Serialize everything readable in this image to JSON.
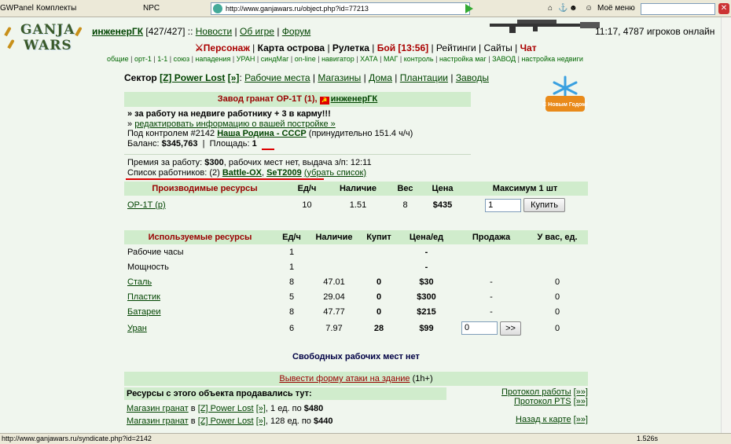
{
  "browser": {
    "toolbar_items": [
      "GWPanel",
      "Комплекты",
      "NPC"
    ],
    "url": "http://www.ganjawars.ru/object.php?id=77213",
    "menu_label": "Моё меню",
    "status_url": "http://www.ganjawars.ru/syndicate.php?id=2142",
    "load_time": "1.526s"
  },
  "logo": {
    "line1": "GANJA",
    "line2": "WARS"
  },
  "header": {
    "username": "инженерГК",
    "hp": "[427/427]",
    "links": [
      "Новости",
      "Об игре",
      "Форум"
    ],
    "clock": "11:17, 4787 игроков онлайн"
  },
  "nav": {
    "items": [
      "Персонаж",
      "Карта острова",
      "Рулетка",
      "Бой [13:56]",
      "Рейтинги",
      "Сайты",
      "Чат"
    ],
    "sub": [
      "общие",
      "орт-1",
      "1-1",
      "союз",
      "нападения",
      "УРАН",
      "синдМаг",
      "on-line",
      "навигатор",
      "ХАТА",
      "МАГ",
      "контроль",
      "настройка маг",
      "ЗАВОД",
      "настройка недвиги"
    ]
  },
  "sector": {
    "label": "Сектор",
    "name": "[Z] Power Lost",
    "arrow": "[»]",
    "links": [
      "Рабочие места",
      "Магазины",
      "Дома",
      "Плантации",
      "Заводы"
    ]
  },
  "snowflake_text": "С Новым Годом!",
  "factory": {
    "name": "Завод гранат OP-1T",
    "level": "(1),",
    "owner": "инженерГК",
    "karma_line": "» за работу на недвиге работнику + 3 в карму!!!",
    "edit_link": "редактировать информацию о вашей постройке »",
    "control_prefix": "Под контролем #2142",
    "control_name": "Наша Родина - СССР",
    "control_suffix": "(принудительно 151.4 ч/ч)",
    "balance_label": "Баланс:",
    "balance": "$345,763",
    "area_label": "Площадь:",
    "area": "1",
    "premium_label": "Премия за работу:",
    "premium": "$300",
    "premium_rest": ", рабочих мест нет, выдача з/п: 12:11",
    "workers_label": "Список работников: (2)",
    "workers": [
      "Battle-OX",
      "SeT2009"
    ],
    "remove_list": "(убрать список)"
  },
  "produced": {
    "headers": [
      "Производимые ресурсы",
      "Ед/ч",
      "Наличие",
      "Вес",
      "Цена",
      "Максимум 1 шт"
    ],
    "row": {
      "name": "OP-1T (р)",
      "rate": "10",
      "stock": "1.51",
      "weight": "8",
      "price": "$435",
      "qty": "1",
      "buy": "Купить"
    }
  },
  "used": {
    "headers": [
      "Используемые ресурсы",
      "Ед/ч",
      "Наличие",
      "Купит",
      "Цена/ед",
      "Продажа",
      "У вас, ед."
    ],
    "rows": [
      {
        "name": "Рабочие часы",
        "rate": "1",
        "stock": "",
        "buys": "",
        "price": "-",
        "sale": "",
        "have": "",
        "link": false
      },
      {
        "name": "Мощность",
        "rate": "1",
        "stock": "",
        "buys": "",
        "price": "-",
        "sale": "",
        "have": "",
        "link": false
      },
      {
        "name": "Сталь",
        "rate": "8",
        "stock": "47.01",
        "buys": "0",
        "price": "$30",
        "sale": "-",
        "have": "0",
        "link": true
      },
      {
        "name": "Пластик",
        "rate": "5",
        "stock": "29.04",
        "buys": "0",
        "price": "$300",
        "sale": "-",
        "have": "0",
        "link": true
      },
      {
        "name": "Батареи",
        "rate": "8",
        "stock": "47.77",
        "buys": "0",
        "price": "$215",
        "sale": "-",
        "have": "0",
        "link": true
      },
      {
        "name": "Уран",
        "rate": "6",
        "stock": "7.97",
        "buys": "28",
        "price": "$99",
        "sale": "input",
        "have": "0",
        "link": true
      }
    ],
    "sale_input": "0",
    "sale_button": ">>"
  },
  "free_places": "Свободных рабочих мест нет",
  "attack_link": "Вывести форму атаки на здание",
  "attack_suffix": "(1h+)",
  "sold": {
    "title": "Ресурсы с этого объекта продавались тут:",
    "rows": [
      {
        "shop": "Магазин гранат",
        "in": "в",
        "sector": "[Z] Power Lost",
        "arrow": "[»]",
        "rest": ", 1 ед. по",
        "price": "$480"
      },
      {
        "shop": "Магазин гранат",
        "in": "в",
        "sector": "[Z] Power Lost",
        "arrow": "[»]",
        "rest": ", 128 ед. по",
        "price": "$440"
      }
    ]
  },
  "right_links": [
    {
      "label": "Протокол работы",
      "arrow": "[»»]"
    },
    {
      "label": "Протокол PTS",
      "arrow": "[»»]"
    },
    {
      "label": "Назад к карте",
      "arrow": "[»»]"
    }
  ]
}
